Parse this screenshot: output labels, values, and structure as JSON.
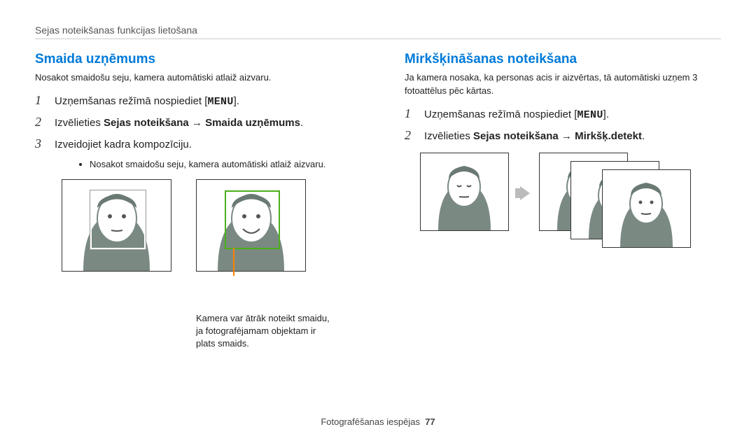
{
  "breadcrumb": "Sejas noteikšanas funkcijas lietošana",
  "left": {
    "heading": "Smaida uzņēmums",
    "intro": "Nosakot smaidošu seju, kamera automātiski atlaiž aizvaru.",
    "steps": {
      "1": {
        "num": "1",
        "prefix": "Uzņemšanas režīmā nospiediet [",
        "menu": "MENU",
        "suffix": "]."
      },
      "2": {
        "num": "2",
        "prefix": "Izvēlieties ",
        "bold": "Sejas noteikšana → Smaida uzņēmums",
        "suffix": "."
      },
      "3": {
        "num": "3",
        "text": "Izveidojiet kadra kompozīciju."
      }
    },
    "sub_bullet": "Nosakot smaidošu seju, kamera automātiski atlaiž aizvaru.",
    "caption": "Kamera var ātrāk noteikt smaidu, ja fotografējamam objektam ir plats smaids."
  },
  "right": {
    "heading": "Mirkšķināšanas noteikšana",
    "intro": "Ja kamera nosaka, ka personas acis ir aizvērtas, tā automātiski uzņem 3 fotoattēlus pēc kārtas.",
    "steps": {
      "1": {
        "num": "1",
        "prefix": "Uzņemšanas režīmā nospiediet [",
        "menu": "MENU",
        "suffix": "]."
      },
      "2": {
        "num": "2",
        "prefix": "Izvēlieties ",
        "bold": "Sejas noteikšana → Mirkšķ.detekt",
        "suffix": "."
      }
    }
  },
  "footer": {
    "section": "Fotografēšanas iespējas",
    "page": "77"
  }
}
